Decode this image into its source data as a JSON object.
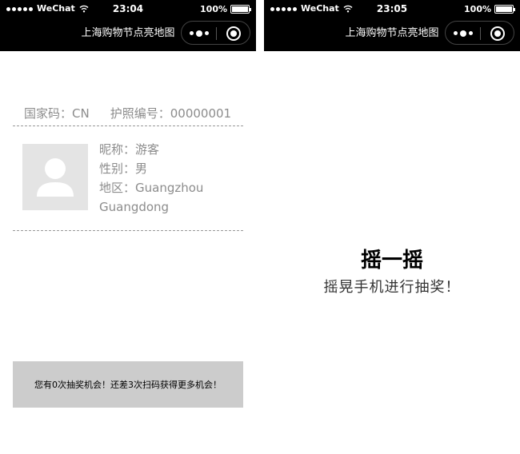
{
  "screens": [
    {
      "status": {
        "carrier": "WeChat",
        "time": "23:04",
        "battery": "100%"
      },
      "nav_title": "上海购物节点亮地图",
      "passport": {
        "country_label": "国家码：",
        "country_value": "CN",
        "passport_label": "护照编号：",
        "passport_value": "00000001"
      },
      "profile": {
        "nickname": "昵称：游客",
        "gender": "性别：男",
        "region": "地区：Guangzhou Guangdong"
      },
      "lottery_notice": "您有0次抽奖机会！还差3次扫码获得更多机会！"
    },
    {
      "status": {
        "carrier": "WeChat",
        "time": "23:05",
        "battery": "100%"
      },
      "nav_title": "上海购物节点亮地图",
      "shake": {
        "title": "摇一摇",
        "subtitle": "摇晃手机进行抽奖！"
      }
    }
  ],
  "icons": {
    "signal": "signal-dots-icon",
    "wifi": "wifi-icon",
    "battery": "battery-icon",
    "more": "more-dots-icon",
    "close": "close-target-icon",
    "avatar": "avatar-placeholder-icon"
  },
  "colors": {
    "topbar": "#000000",
    "muted_text": "#8c8c8c",
    "lottery_bar": "#cccccc",
    "avatar_bg": "#e4e4e4"
  }
}
